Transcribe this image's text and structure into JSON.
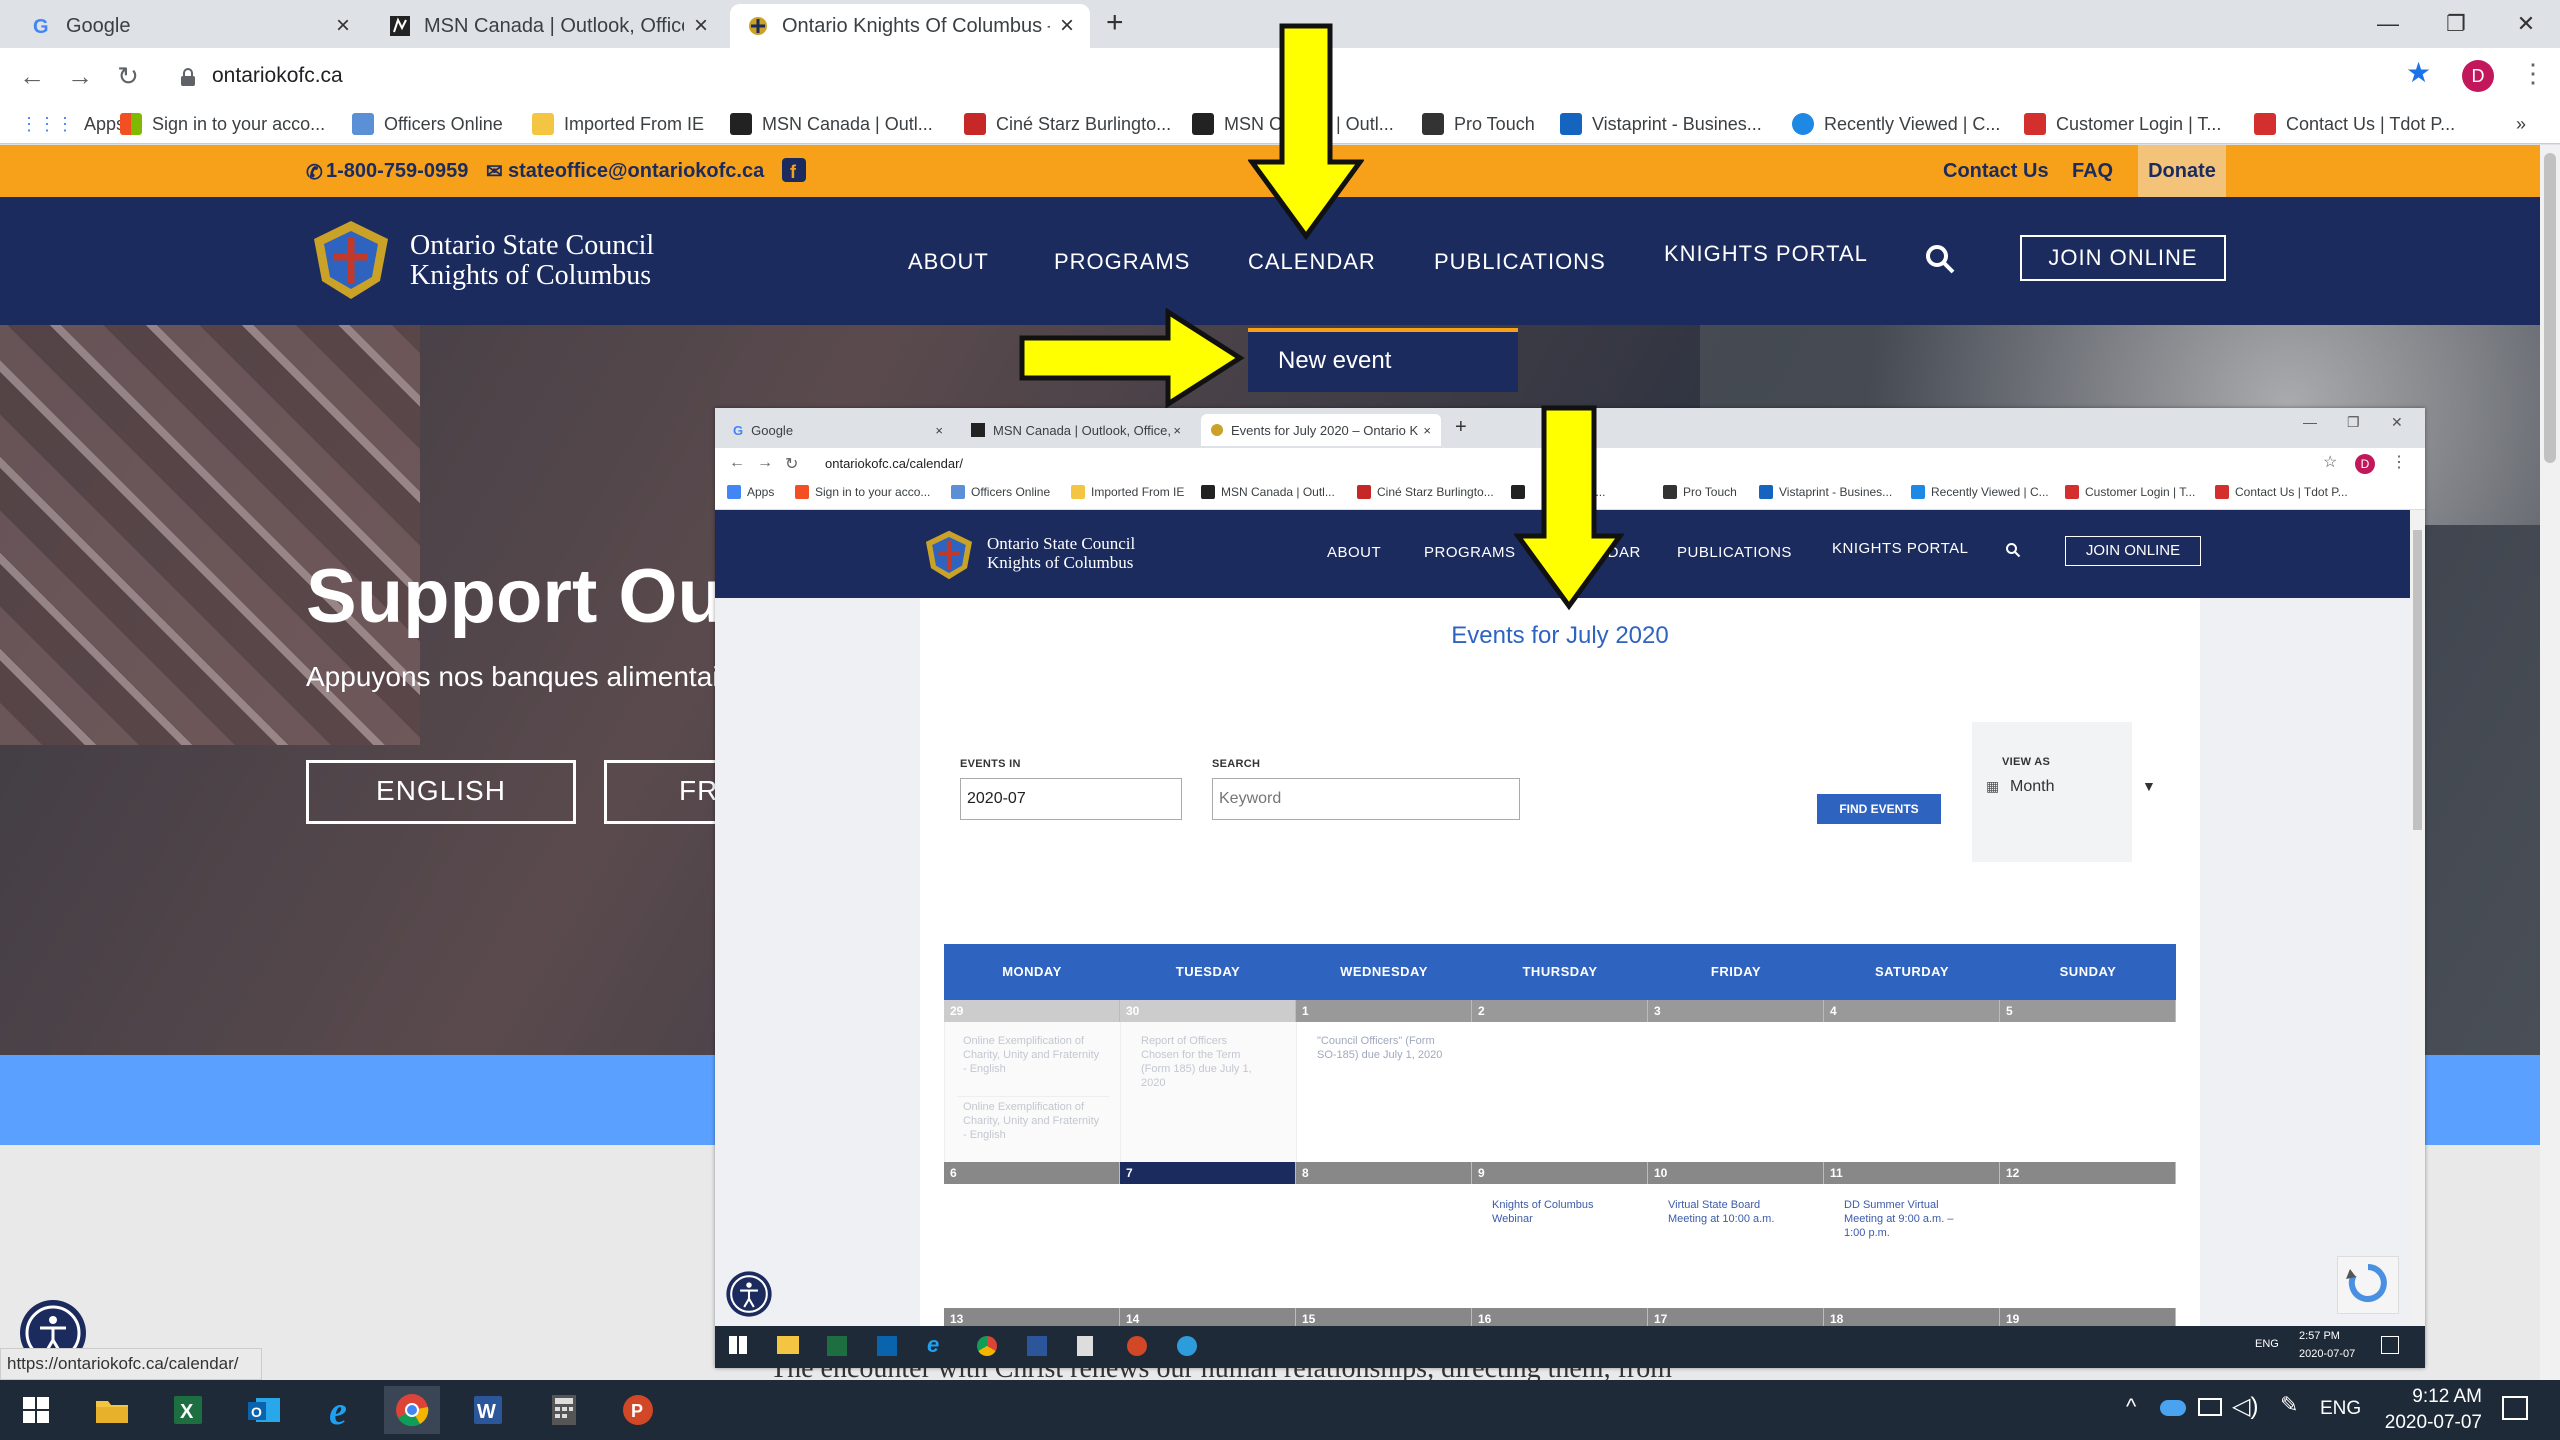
{
  "browser": {
    "tabs": [
      {
        "title": "Google",
        "icon": "google-icon"
      },
      {
        "title": "MSN Canada | Outlook, Office, Sl",
        "icon": "msn-icon"
      },
      {
        "title": "Ontario Knights Of Columbus – C",
        "icon": "kofc-icon"
      }
    ],
    "new_tab": "+",
    "url": "ontariokofc.ca",
    "profile_initial": "D",
    "bookmarks": [
      "Apps",
      "Sign in to your acco...",
      "Officers Online",
      "Imported From IE",
      "MSN Canada | Outl...",
      "Ciné Starz Burlingto...",
      "MSN C",
      "| Outl...",
      "Pro Touch",
      "Vistaprint - Busines...",
      "Recently Viewed | C...",
      "Customer Login | T...",
      "Contact Us | Tdot P..."
    ],
    "bookmarks_more": "»"
  },
  "site": {
    "phone": "1-800-759-0959",
    "email": "stateoffice@ontariokofc.ca",
    "top_links": [
      "Contact Us",
      "FAQ",
      "Donate"
    ],
    "brand_line1": "Ontario State Council",
    "brand_line2": "Knights of Columbus",
    "nav": [
      "ABOUT",
      "PROGRAMS",
      "CALENDAR",
      "PUBLICATIONS",
      "KNIGHTS PORTAL"
    ],
    "join": "JOIN ONLINE",
    "dropdown_item": "New event",
    "hero_title": "Support Ou",
    "hero_sub": "Appuyons nos banques alimentair",
    "hero_btn1": "ENGLISH",
    "hero_btn2": "FR",
    "bottom_text": "The encounter with Christ renews our human relationships, directing them, from"
  },
  "inset": {
    "tabs": [
      "Google",
      "MSN Canada | Outlook, Office, Sl",
      "Events for July 2020 – Ontario K"
    ],
    "url": "ontariokofc.ca/calendar/",
    "bookmarks": [
      "Apps",
      "Sign in to your acco...",
      "Officers Online",
      "Imported From IE",
      "MSN Canada | Outl...",
      "Ciné Starz Burlingto...",
      "",
      "| Outl...",
      "Pro Touch",
      "Vistaprint - Busines...",
      "Recently Viewed | C...",
      "Customer Login | T...",
      "Contact Us | Tdot P..."
    ],
    "nav": [
      "ABOUT",
      "PROGRAMS",
      "IDAR",
      "PUBLICATIONS",
      "KNIGHTS PORTAL"
    ],
    "join": "JOIN ONLINE",
    "page_title": "Events for July 2020",
    "events_in_label": "EVENTS IN",
    "events_in_value": "2020-07",
    "search_label": "SEARCH",
    "search_placeholder": "Keyword",
    "find_btn": "FIND EVENTS",
    "view_as_label": "VIEW AS",
    "view_as_value": "Month",
    "weekdays": [
      "MONDAY",
      "TUESDAY",
      "WEDNESDAY",
      "THURSDAY",
      "FRIDAY",
      "SATURDAY",
      "SUNDAY"
    ],
    "week1_days": [
      "29",
      "30",
      "1",
      "2",
      "3",
      "4",
      "5"
    ],
    "week2_days": [
      "6",
      "7",
      "8",
      "9",
      "10",
      "11",
      "12"
    ],
    "week3_days": [
      "13",
      "14",
      "15",
      "16",
      "17",
      "18",
      "19"
    ],
    "events": {
      "mon29_a": "Online Exemplification of Charity, Unity and Fraternity - English",
      "mon29_b": "Online Exemplification of Charity, Unity and Fraternity - English",
      "tue30": "Report of Officers Chosen for the Term (Form 185) due July 1, 2020",
      "wed1": "\"Council Officers\" (Form SO-185) due July 1, 2020",
      "thu9": "Knights of Columbus Webinar",
      "fri10": "Virtual State Board Meeting at 10:00 a.m.",
      "sat11": "DD Summer Virtual Meeting at 9:00 a.m. – 1:00 p.m."
    },
    "tray_time": "2:57 PM",
    "tray_date": "2020-07-07",
    "tray_lang": "ENG"
  },
  "status_url": "https://ontariokofc.ca/calendar/",
  "taskbar": {
    "time": "9:12 AM",
    "date": "2020-07-07",
    "lang": "ENG"
  },
  "colors": {
    "navy": "#1b2b5e",
    "orange": "#f7a11a",
    "calendar_blue": "#2f63c0",
    "arrow": "#ffff00"
  }
}
